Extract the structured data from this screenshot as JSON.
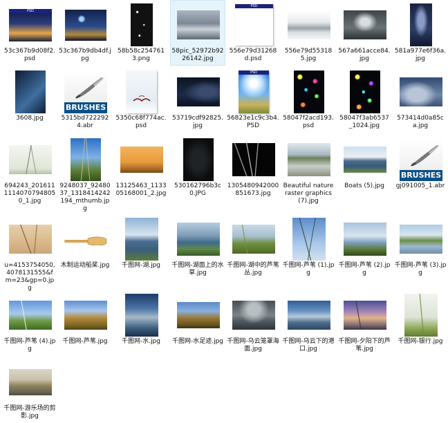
{
  "files": [
    {
      "name": "53c367b9d08f2.psd",
      "thumb": "psd-city-night",
      "psd": true
    },
    {
      "name": "53c367b9db4df.jpg",
      "thumb": "city-night-lightning"
    },
    {
      "name": "58b58c2547613.png",
      "thumb": "dark-sparkle-portrait"
    },
    {
      "name": "58pic_52972b9226142.jpg",
      "thumb": "cloudy-sky-gray",
      "selected": true
    },
    {
      "name": "556e79d31268d.psd",
      "thumb": "blank-psd",
      "psd": true
    },
    {
      "name": "556e79d553185.jpg",
      "thumb": "misty-landscape"
    },
    {
      "name": "567a661acce84.jpg",
      "thumb": "storm-clouds-dark"
    },
    {
      "name": "581a977e6f36a.jpg",
      "thumb": "night-clouds-blue"
    },
    {
      "name": "3608.jpg",
      "thumb": "dark-blue-bridge"
    },
    {
      "name": "5315bd7222924.abr",
      "thumb": "brushes-icon"
    },
    {
      "name": "5350c68f774ac.psd",
      "thumb": "white-birds-doc"
    },
    {
      "name": "53719cdf92825.jpg",
      "thumb": "dark-blue-clouds"
    },
    {
      "name": "56823e1c9c3b4.PSD",
      "thumb": "bright-blue-sky-grass",
      "psd": true
    },
    {
      "name": "58047f2acd193.psd",
      "thumb": "colorful-light-stars"
    },
    {
      "name": "58047f3ab6537_1024.jpg",
      "thumb": "colorful-light-stars-2"
    },
    {
      "name": "573414d0a85ca.jpg",
      "thumb": "blue-clouds-sky"
    },
    {
      "name": "694243_2016111114070794805 0_1.jpg",
      "thumb": "reed-white-bg"
    },
    {
      "name": "9248037_9248037_1318414242194_mthumb.jpg",
      "thumb": "reed-blue-sky"
    },
    {
      "name": "13125463_113305168001_2.jpg",
      "thumb": "orange-sunset-grass"
    },
    {
      "name": "530162796b3c0.JPG",
      "thumb": "black-texture"
    },
    {
      "name": "1305480942000851673.jpg",
      "thumb": "white-reeds-black"
    },
    {
      "name": "Beautiful nature raster graphics (7).jpg",
      "thumb": "boat-lake"
    },
    {
      "name": "Boats (5).jpg",
      "thumb": "boats-shore"
    },
    {
      "name": "gj091005_1.abr",
      "thumb": "brushes-icon"
    },
    {
      "name": "u=4153754050,4078131555&fm=23&gp=0.jpg",
      "thumb": "reed-beige"
    },
    {
      "name": "木制运动船桨.jpg",
      "thumb": "wooden-paddle"
    },
    {
      "name": "千图网-湖.jpg",
      "thumb": "lake-reeds"
    },
    {
      "name": "千图网-湖面上的水草.jpg",
      "thumb": "lake-grass"
    },
    {
      "name": "千图网-湖中的芦苇丛.jpg",
      "thumb": "reeds-lake"
    },
    {
      "name": "千图网-芦苇 (1).jpg",
      "thumb": "reed-sky-tall"
    },
    {
      "name": "千图网-芦苇 (2).jpg",
      "thumb": "reed-shore"
    },
    {
      "name": "千图网-芦苇 (3).jpg",
      "thumb": "reed-lake-2"
    },
    {
      "name": "千图网-芦苇 (4).jpg",
      "thumb": "reed-green-sky"
    },
    {
      "name": "千图网-芦苇.jpg",
      "thumb": "reed-golden"
    },
    {
      "name": "千图网-水.jpg",
      "thumb": "water-reflection"
    },
    {
      "name": "千图网-水足迹.jpg",
      "thumb": "water-grass"
    },
    {
      "name": "千图网-乌云笼罩海面.jpg",
      "thumb": "dark-sea-clouds"
    },
    {
      "name": "千图网-乌云下的港口.jpg",
      "thumb": "harbor-clouds"
    },
    {
      "name": "千图网-夕阳下的芦苇.jpg",
      "thumb": "sunset-reeds"
    },
    {
      "name": "千图网-银行.jpg",
      "thumb": "reeds-white-fog"
    },
    {
      "name": "千图网-游乐场的剪影.jpg",
      "thumb": "old-boat"
    }
  ],
  "colors": {
    "selection_bg": "#e5f3fb",
    "selection_border": "#cde8f7",
    "brush_bar": "#0b4f86",
    "psd_bar": "#1a237e"
  },
  "icons": {
    "brushes_label": "BRUSHES",
    "psd_label": "PSD"
  }
}
